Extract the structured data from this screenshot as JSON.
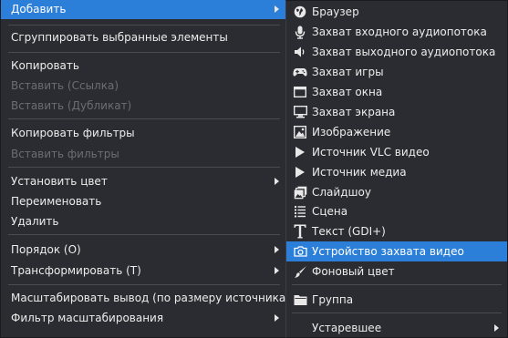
{
  "main_menu": {
    "add": "Добавить",
    "group_selected": "Сгруппировать выбранные элементы",
    "copy": "Копировать",
    "paste_reference": "Вставить (Ссылка)",
    "paste_duplicate": "Вставить (Дубликат)",
    "copy_filters": "Копировать фильтры",
    "paste_filters": "Вставить фильтры",
    "set_color": "Установить цвет",
    "rename": "Переименовать",
    "delete": "Удалить",
    "order": "Порядок (О)",
    "transform": "Трансформировать (Т)",
    "scale_output": "Масштабировать вывод (по размеру источника)",
    "scale_filter": "Фильтр масштабирования"
  },
  "sub_menu": {
    "items": [
      {
        "label": "Браузер",
        "icon": "globe-icon"
      },
      {
        "label": "Захват входного аудиопотока",
        "icon": "microphone-icon"
      },
      {
        "label": "Захват выходного аудиопотока",
        "icon": "speaker-icon"
      },
      {
        "label": "Захват игры",
        "icon": "gamepad-icon"
      },
      {
        "label": "Захват окна",
        "icon": "window-icon"
      },
      {
        "label": "Захват экрана",
        "icon": "monitor-icon"
      },
      {
        "label": "Изображение",
        "icon": "image-icon"
      },
      {
        "label": "Источник VLC видео",
        "icon": "play-icon"
      },
      {
        "label": "Источник медиа",
        "icon": "play-icon"
      },
      {
        "label": "Слайдшоу",
        "icon": "slideshow-icon"
      },
      {
        "label": "Сцена",
        "icon": "list-icon"
      },
      {
        "label": "Текст (GDI+)",
        "icon": "text-icon"
      },
      {
        "label": "Устройство захвата видео",
        "icon": "camera-icon"
      },
      {
        "label": "Фоновый цвет",
        "icon": "brush-icon"
      },
      {
        "label": "Группа",
        "icon": "folder-icon"
      },
      {
        "label": "Устаревшее",
        "icon": ""
      }
    ],
    "highlighted_item": "Устройство захвата видео"
  },
  "colors": {
    "menu_bg": "#2b2c31",
    "highlight": "#2c7fd9",
    "disabled_text": "#6c6d72",
    "text": "#ededed"
  }
}
